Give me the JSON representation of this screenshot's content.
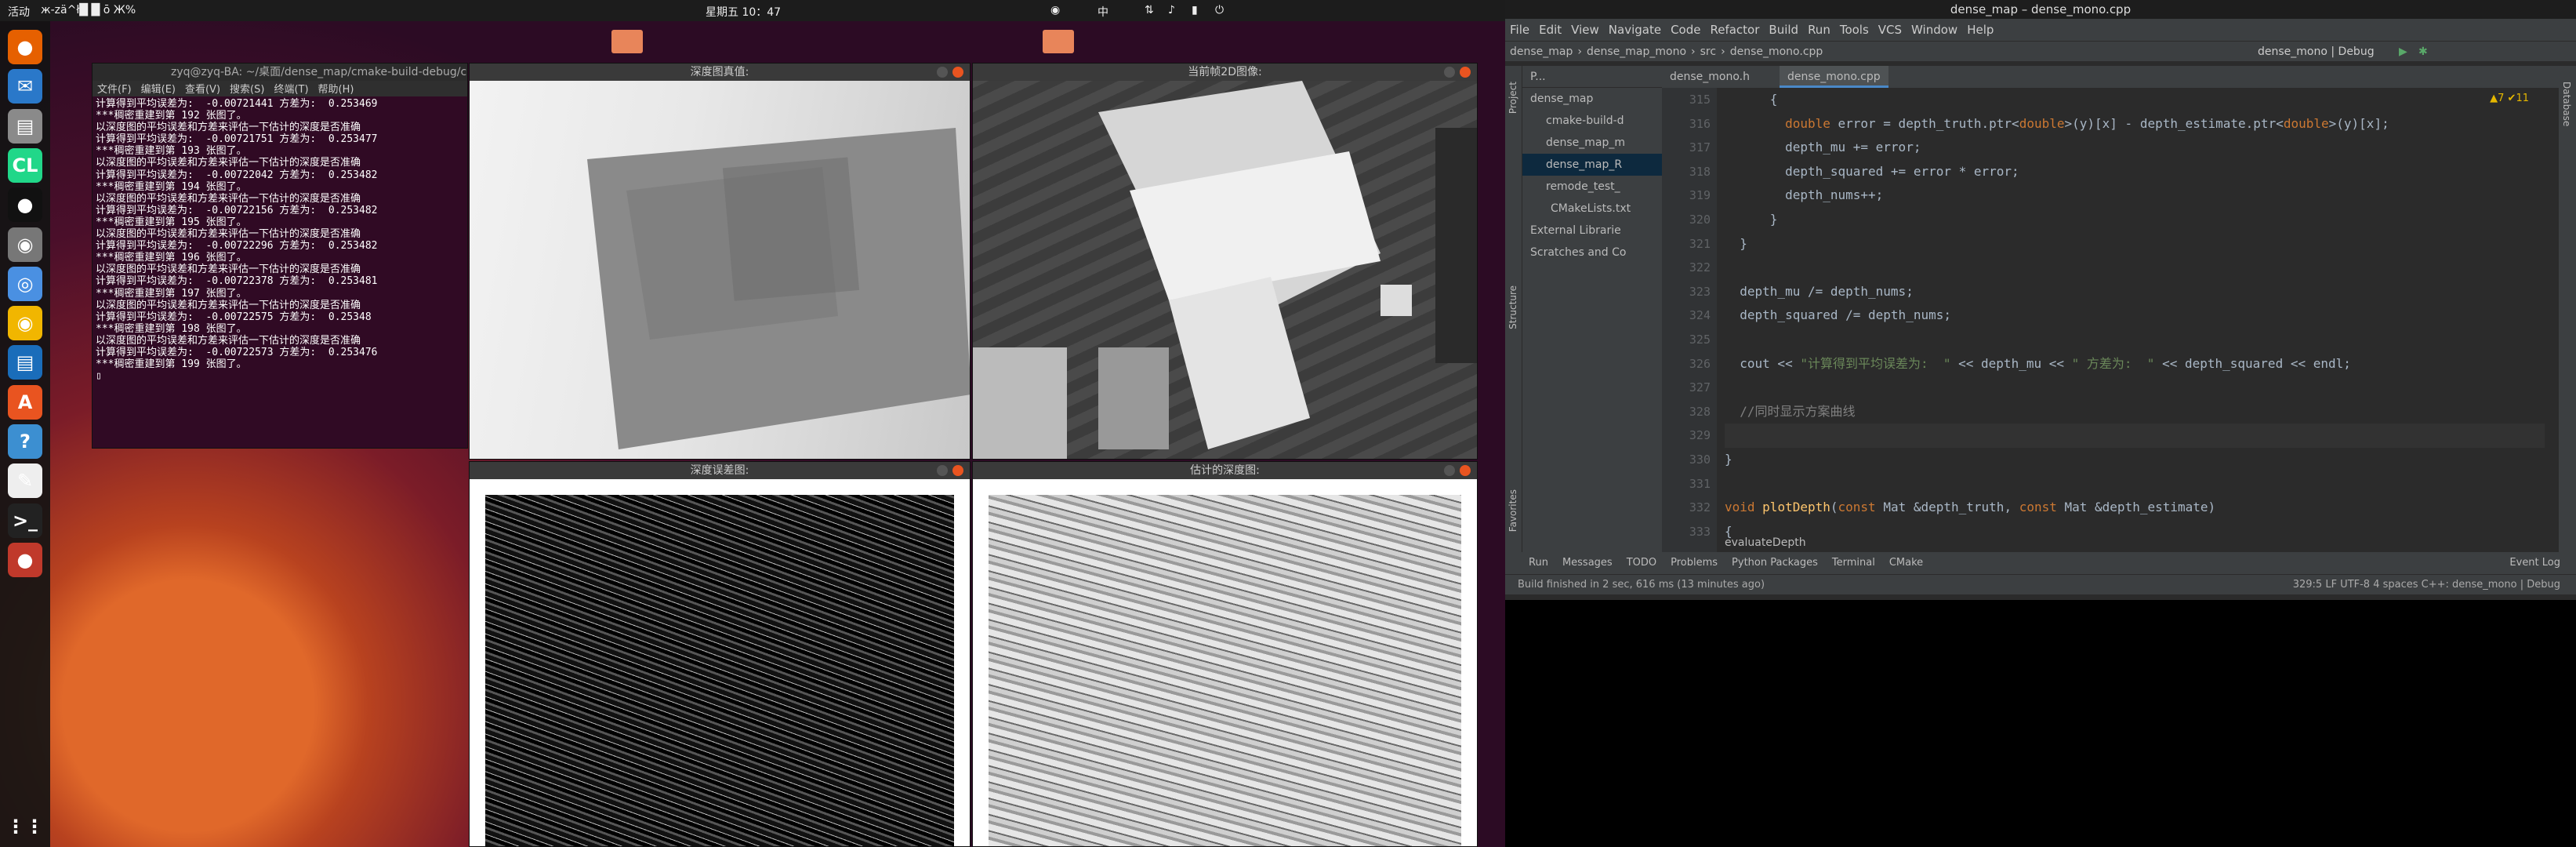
{
  "topbar": {
    "activities": "活动",
    "app": "ж-zä^ł█ █ ō Ж%",
    "clock": "星期五 10：47",
    "lang": "中"
  },
  "dock": [
    {
      "name": "firefox-icon",
      "glyph": "●",
      "color": "#e66000"
    },
    {
      "name": "thunderbird-icon",
      "glyph": "✉",
      "color": "#2a78c9"
    },
    {
      "name": "files-icon",
      "glyph": "▤",
      "color": "#8a8a8a"
    },
    {
      "name": "clion-icon",
      "glyph": "CL",
      "color": "#21d789"
    },
    {
      "name": "qq-icon",
      "glyph": "●",
      "color": "#111"
    },
    {
      "name": "eye-icon",
      "glyph": "◉",
      "color": "#777"
    },
    {
      "name": "baidu-disk-icon",
      "glyph": "◎",
      "color": "#4a90e2"
    },
    {
      "name": "rhythmbox-icon",
      "glyph": "◉",
      "color": "#f1b600"
    },
    {
      "name": "writer-icon",
      "glyph": "▤",
      "color": "#1a6dba"
    },
    {
      "name": "software-icon",
      "glyph": "A",
      "color": "#e95420"
    },
    {
      "name": "help-icon",
      "glyph": "?",
      "color": "#3c8fd1"
    },
    {
      "name": "text-editor-icon",
      "glyph": "✎",
      "color": "#eee"
    },
    {
      "name": "terminal-icon",
      "glyph": ">_",
      "color": "#222"
    },
    {
      "name": "screenshot-icon",
      "glyph": "●",
      "color": "#c0392b"
    }
  ],
  "terminal": {
    "title": "zyq@zyq-BA: ~/桌面/dense_map/cmake-build-debug/c",
    "menu": [
      "文件(F)",
      "编辑(E)",
      "查看(V)",
      "搜索(S)",
      "终端(T)",
      "帮助(H)"
    ],
    "lines": [
      "计算得到平均误差为:  -0.00721441 方差为:  0.253469",
      "***稠密重建到第 192 张图了。",
      "以深度图的平均误差和方差来评估一下估计的深度是否准确",
      "计算得到平均误差为:  -0.00721751 方差为:  0.253477",
      "***稠密重建到第 193 张图了。",
      "以深度图的平均误差和方差来评估一下估计的深度是否准确",
      "计算得到平均误差为:  -0.00722042 方差为:  0.253482",
      "***稠密重建到第 194 张图了。",
      "以深度图的平均误差和方差来评估一下估计的深度是否准确",
      "计算得到平均误差为:  -0.00722156 方差为:  0.253482",
      "***稠密重建到第 195 张图了。",
      "以深度图的平均误差和方差来评估一下估计的深度是否准确",
      "计算得到平均误差为:  -0.00722296 方差为:  0.253482",
      "***稠密重建到第 196 张图了。",
      "以深度图的平均误差和方差来评估一下估计的深度是否准确",
      "计算得到平均误差为:  -0.00722378 方差为:  0.253481",
      "***稠密重建到第 197 张图了。",
      "以深度图的平均误差和方差来评估一下估计的深度是否准确",
      "计算得到平均误差为:  -0.00722575 方差为:  0.25348",
      "***稠密重建到第 198 张图了。",
      "以深度图的平均误差和方差来评估一下估计的深度是否准确",
      "计算得到平均误差为:  -0.00722573 方差为:  0.253476",
      "***稠密重建到第 199 张图了。"
    ]
  },
  "windows": {
    "gt": "深度图真值:",
    "rgb": "当前帧2D图像:",
    "err": "深度误差图:",
    "est": "估计的深度图:"
  },
  "ide": {
    "title": "dense_map – dense_mono.cpp",
    "menu": [
      "File",
      "Edit",
      "View",
      "Navigate",
      "Code",
      "Refactor",
      "Build",
      "Run",
      "Tools",
      "VCS",
      "Window",
      "Help"
    ],
    "breadcrumb": [
      "dense_map",
      "dense_map_mono",
      "src",
      "dense_mono.cpp"
    ],
    "runconfig": "dense_mono | Debug",
    "tabs": [
      "dense_mono.h",
      "dense_mono.cpp"
    ],
    "project_header": "P...",
    "project": [
      "dense_map",
      "cmake-build-d",
      "dense_map_m",
      "dense_map_R",
      "remode_test_",
      "CMakeLists.txt",
      "External Librarie",
      "Scratches and Co"
    ],
    "gutter": [
      "315",
      "316",
      "317",
      "318",
      "319",
      "320",
      "321",
      "322",
      "323",
      "324",
      "325",
      "326",
      "327",
      "328",
      "329",
      "330",
      "331",
      "332",
      "333"
    ],
    "code": [
      [
        [
          "",
          "      {"
        ]
      ],
      [
        [
          "",
          "        "
        ],
        [
          "ty",
          "double"
        ],
        [
          "",
          " error = depth_truth.ptr<"
        ],
        [
          "ty",
          "double"
        ],
        [
          "",
          ">(y)[x] - depth_estimate.ptr<"
        ],
        [
          "ty",
          "double"
        ],
        [
          "",
          ">(y)[x];"
        ]
      ],
      [
        [
          "",
          "        depth_mu += error;"
        ]
      ],
      [
        [
          "",
          "        depth_squared += error * error;"
        ]
      ],
      [
        [
          "",
          "        depth_nums++;"
        ]
      ],
      [
        [
          "",
          "      }"
        ]
      ],
      [
        [
          "",
          "  }"
        ]
      ],
      [
        [
          "",
          ""
        ]
      ],
      [
        [
          "",
          "  depth_mu /= depth_nums;"
        ]
      ],
      [
        [
          "",
          "  depth_squared /= depth_nums;"
        ]
      ],
      [
        [
          "",
          ""
        ]
      ],
      [
        [
          "",
          "  cout << "
        ],
        [
          "str",
          "\"计算得到平均误差为:  \""
        ],
        [
          "",
          " << depth_mu << "
        ],
        [
          "str",
          "\" 方差为:  \""
        ],
        [
          "",
          " << depth_squared << endl;"
        ]
      ],
      [
        [
          "",
          ""
        ]
      ],
      [
        [
          "cm",
          "  //同时显示方案曲线"
        ]
      ],
      [
        [
          "",
          ""
        ]
      ],
      [
        [
          "",
          "}"
        ]
      ],
      [
        [
          "",
          ""
        ]
      ],
      [
        [
          "kw",
          "void "
        ],
        [
          "fn",
          "plotDepth"
        ],
        [
          "",
          "("
        ],
        [
          "kw",
          "const "
        ],
        [
          "",
          "Mat &depth_truth, "
        ],
        [
          "kw",
          "const "
        ],
        [
          "",
          "Mat &depth_estimate)"
        ]
      ],
      [
        [
          "",
          "{"
        ]
      ]
    ],
    "breadcrumb_fn": "evaluateDepth",
    "bottom_tabs": [
      "Run",
      "Messages",
      "TODO",
      "Problems",
      "Python Packages",
      "Terminal",
      "CMake"
    ],
    "event_log": "Event Log",
    "status": "Build finished in 2 sec, 616 ms (13 minutes ago)",
    "status_right": "329:5  LF  UTF-8  4 spaces  C++: dense_mono | Debug",
    "inspections": "▲7 ✔11",
    "side_left": [
      "Project",
      "Structure",
      "Favorites"
    ],
    "side_right": [
      "Database"
    ]
  }
}
